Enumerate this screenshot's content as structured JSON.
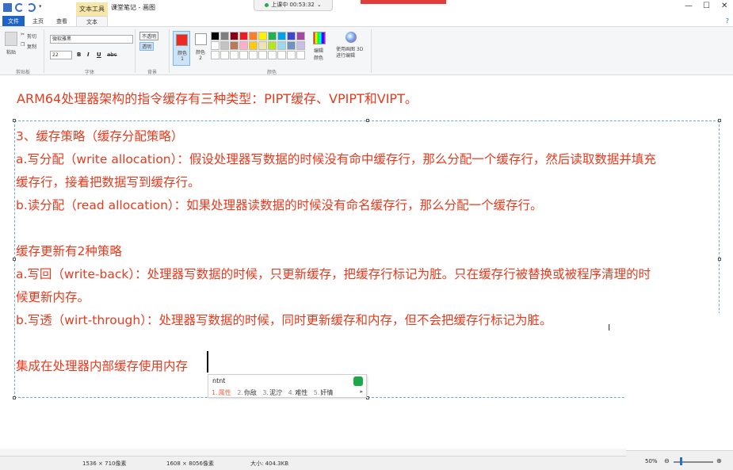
{
  "titlebar": {
    "context_tab": "文本工具",
    "title": "课堂笔记 - 画图",
    "recording": "上课中 00:53:32",
    "minimize": "—",
    "maximize": "☐",
    "close": "✕"
  },
  "tabs": {
    "file": "文件",
    "home": "主页",
    "view": "查看",
    "text": "文本"
  },
  "ribbon": {
    "clipboard": {
      "paste": "粘贴",
      "cut": "剪切",
      "copy": "复制",
      "label": "剪贴板"
    },
    "font": {
      "family": "微软雅黑",
      "size": "22",
      "bold": "B",
      "italic": "I",
      "underline": "U",
      "strike": "abc",
      "label": "字体"
    },
    "background": {
      "opaque": "不透明",
      "transparent": "透明",
      "label": "背景"
    },
    "colors": {
      "color1_label": "颜色 1",
      "color2_label": "颜色 2",
      "edit_colors": "编辑颜色",
      "paint3d": "使用画图 3D 进行编辑",
      "label": "颜色",
      "color1": "#ec2a22",
      "color2": "#ffffff",
      "palette": [
        "#000000",
        "#7f7f7f",
        "#880015",
        "#ed1c24",
        "#ff7f27",
        "#fff200",
        "#22b14c",
        "#00a2e8",
        "#3f48cc",
        "#a349a4",
        "#ffffff",
        "#c3c3c3",
        "#b97a57",
        "#ffaec9",
        "#ffc90e",
        "#efe4b0",
        "#b5e61d",
        "#99d9ea",
        "#7092be",
        "#c8bfe7",
        "#ffffff",
        "#ffffff",
        "#ffffff",
        "#ffffff",
        "#ffffff",
        "#ffffff",
        "#ffffff",
        "#ffffff",
        "#ffffff",
        "#ffffff"
      ]
    }
  },
  "canvas": {
    "heading": "ARM64处理器架构的指令缓存有三种类型：PIPT缓存、VPIPT和VIPT。",
    "lines": [
      "3、缓存策略（缓存分配策略）",
      "a.写分配（write allocation）：假设处理器写数据的时候没有命中缓存行，那么分配一个缓存行，然后读取数据并填充",
      "缓存行，接着把数据写到缓存行。",
      "b.读分配（read allocation）：如果处理器读数据的时候没有命名缓存行，那么分配一个缓存行。",
      "缓存更新有2种策略",
      "a.写回（write-back）：处理器写数据的时候，只更新缓存，把缓存行标记为脏。只在缓存行被替换或被程序清理的时",
      "候更新内存。",
      "b.写透（wirt-through）：处理器写数据的时候，同时更新缓存和内存，但不会把缓存行标记为脏。"
    ],
    "typing": "集成在处理器内部缓存使用内存",
    "text_color": "#e83a1e"
  },
  "ime": {
    "input": "ntnt",
    "candidates": [
      {
        "n": "1.",
        "text": "属性"
      },
      {
        "n": "2.",
        "text": "你敌"
      },
      {
        "n": "3.",
        "text": "泥泞"
      },
      {
        "n": "4.",
        "text": "难性"
      },
      {
        "n": "5.",
        "text": "奸情"
      }
    ]
  },
  "status": {
    "cursor": "1536 × 710像素",
    "selection": "1608 × 8056像素",
    "size": "大小: 404.3KB",
    "zoom": "50%"
  }
}
